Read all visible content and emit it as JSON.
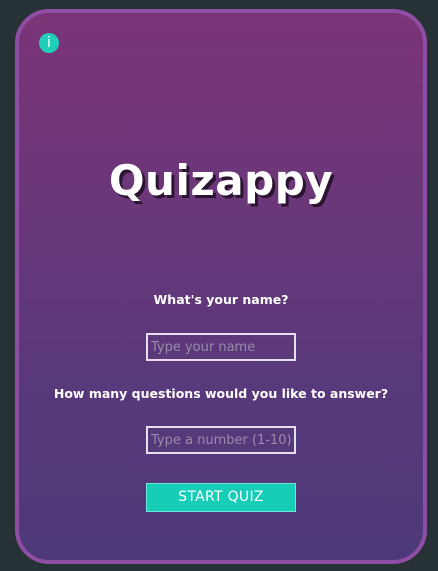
{
  "app": {
    "title": "Quizappy",
    "info_glyph": "i",
    "info_icon": "info-icon"
  },
  "form": {
    "name_label": "What's your name?",
    "name_placeholder": "Type your name",
    "name_value": "",
    "questions_label": "How many questions would you like to answer?",
    "questions_placeholder": "Type a number (1-10)",
    "questions_value": "",
    "start_label": "START QUIZ"
  },
  "colors": {
    "page_background": "#273236",
    "card_border": "#8d4ea3",
    "card_gradient_top": "#7b3478",
    "card_gradient_bottom": "#4d397a",
    "accent": "#16cdb8"
  }
}
